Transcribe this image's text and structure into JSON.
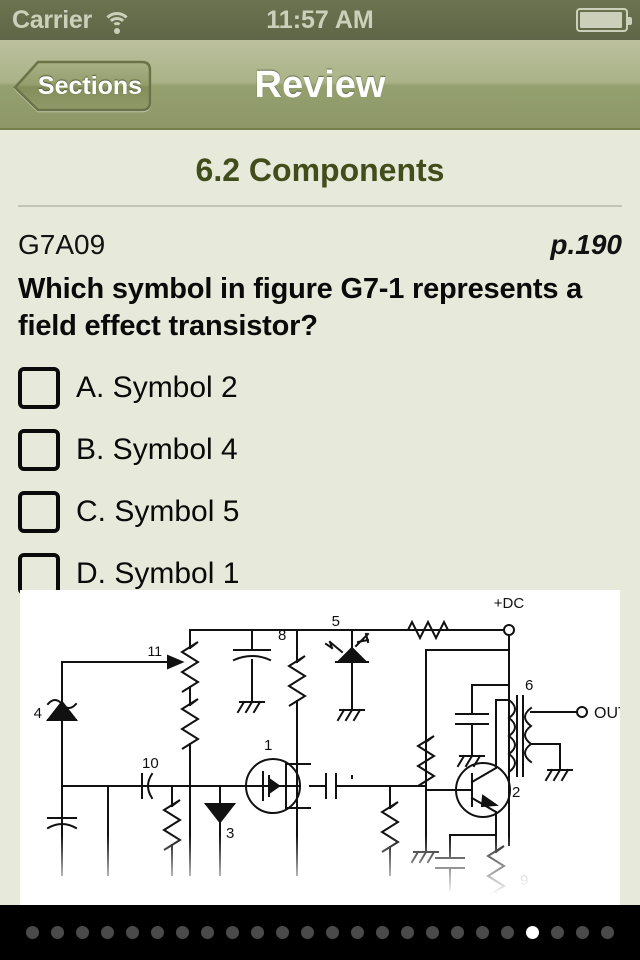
{
  "statusbar": {
    "carrier": "Carrier",
    "time": "11:57 AM",
    "wifi_icon": "wifi-icon",
    "battery_icon": "battery-icon"
  },
  "navbar": {
    "back_label": "Sections",
    "title": "Review"
  },
  "content": {
    "section_title": "6.2 Components",
    "question_id": "G7A09",
    "page_ref": "p.190",
    "question_text": "Which symbol in figure G7-1 represents a field effect transistor?",
    "choices": [
      {
        "label": "A. Symbol 2",
        "checked": false
      },
      {
        "label": "B. Symbol 4",
        "checked": false
      },
      {
        "label": "C. Symbol 5",
        "checked": false
      },
      {
        "label": "D. Symbol 1",
        "checked": false
      }
    ]
  },
  "figure": {
    "name": "figure-g7-1-schematic",
    "supply_label": "+DC",
    "output_label": "OUT",
    "component_numbers": [
      "1",
      "2",
      "3",
      "4",
      "5",
      "6",
      "8",
      "9",
      "10",
      "11"
    ]
  },
  "pager": {
    "total": 24,
    "active_index": 20
  },
  "colors": {
    "statusbar_bg": "#5e6647",
    "navbar_top": "#bcc09e",
    "navbar_bottom": "#8d9768",
    "page_bg": "#e7eada",
    "title_green": "#424d1c",
    "pager_bg": "#000000",
    "pager_active": "#ffffff",
    "pager_inactive": "#4a4a4a"
  }
}
